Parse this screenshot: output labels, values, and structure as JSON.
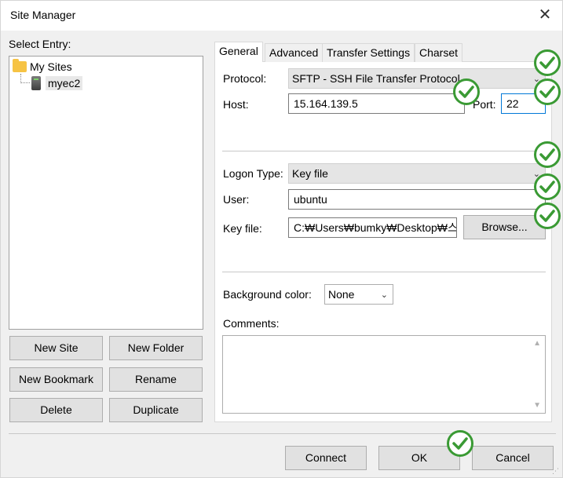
{
  "window": {
    "title": "Site Manager"
  },
  "left": {
    "select_entry_label": "Select Entry:",
    "tree": {
      "root": "My Sites",
      "child": "myec2"
    },
    "buttons": {
      "new_site": "New Site",
      "new_folder": "New Folder",
      "new_bookmark": "New Bookmark",
      "rename": "Rename",
      "delete": "Delete",
      "duplicate": "Duplicate"
    }
  },
  "tabs": [
    "General",
    "Advanced",
    "Transfer Settings",
    "Charset"
  ],
  "general": {
    "protocol_label": "Protocol:",
    "protocol_value": "SFTP - SSH File Transfer Protocol",
    "host_label": "Host:",
    "host_value": "15.164.139.5",
    "port_label": "Port:",
    "port_value": "22",
    "logon_type_label": "Logon Type:",
    "logon_type_value": "Key file",
    "user_label": "User:",
    "user_value": "ubuntu",
    "key_file_label": "Key file:",
    "key_file_value": "C:₩Users₩bumky₩Desktop₩스이",
    "browse_label": "Browse...",
    "bg_color_label": "Background color:",
    "bg_color_value": "None",
    "comments_label": "Comments:"
  },
  "footer": {
    "connect": "Connect",
    "ok": "OK",
    "cancel": "Cancel"
  },
  "colors": {
    "check_green": "#3a9a34",
    "focus_blue": "#0078d7"
  }
}
